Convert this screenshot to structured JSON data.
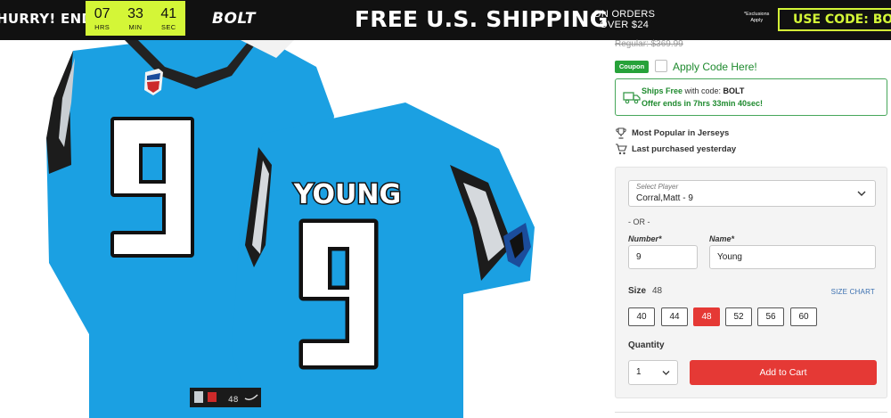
{
  "banner": {
    "hurry_text": "HURRY! ENDS IN:",
    "countdown": [
      {
        "value": "07",
        "label": "HRS"
      },
      {
        "value": "33",
        "label": "MIN"
      },
      {
        "value": "41",
        "label": "SEC"
      }
    ],
    "brand": "BOLT",
    "shipping_text": "FREE U.S. SHIPPING",
    "orders_line1": "ON ORDERS",
    "orders_line2": "OVER $24",
    "exclusions_line1": "*Exclusions",
    "exclusions_line2": "Apply",
    "code_text": "USE CODE: BOLT"
  },
  "product": {
    "jersey_name": "YOUNG",
    "jersey_number": "9",
    "jersey_size_tag": "48"
  },
  "pricing": {
    "regular_label": "Regular: $369.99"
  },
  "coupon": {
    "badge": "Coupon",
    "apply_text": "Apply Code Here!"
  },
  "shipping": {
    "ships_free": "Ships Free",
    "with_code_text": " with code: ",
    "code": "BOLT",
    "offer_text": "Offer ends in 7hrs 33min 40sec!"
  },
  "stats": {
    "popular": "Most Popular in Jerseys",
    "purchased": "Last purchased yesterday"
  },
  "options": {
    "select_player_label": "Select Player",
    "select_player_value": "Corral,Matt - 9",
    "or_text": "- OR -",
    "number_label": "Number*",
    "number_value": "9",
    "name_label": "Name*",
    "name_value": "Young",
    "size_label": "Size",
    "size_value": "48",
    "size_chart": "SIZE CHART",
    "sizes": [
      "40",
      "44",
      "48",
      "52",
      "56",
      "60"
    ],
    "selected_size": "48",
    "quantity_label": "Quantity",
    "quantity_value": "1",
    "add_to_cart": "Add to Cart"
  },
  "colors": {
    "banner_bg": "#111111",
    "accent_lime": "#d4f637",
    "jersey_blue": "#1ba0e2",
    "brand_green": "#27a23a",
    "cta_red": "#e53935"
  }
}
